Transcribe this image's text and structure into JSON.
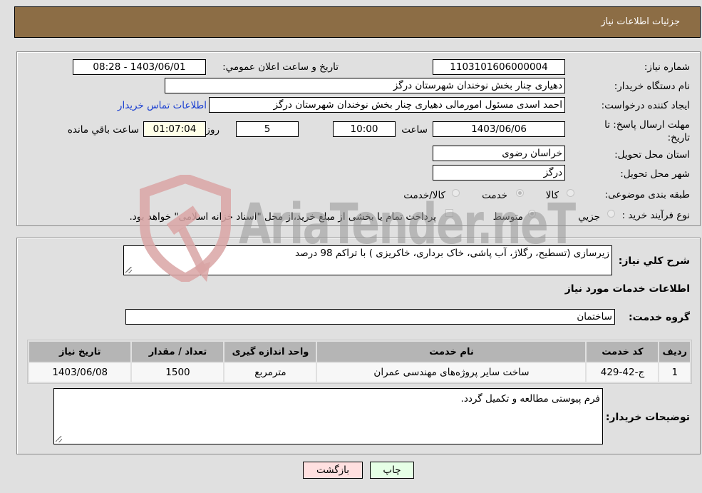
{
  "header": {
    "title": "جزئیات اطلاعات نیاز"
  },
  "form": {
    "need_number": {
      "label": "شماره نیاز:",
      "value": "1103101606000004"
    },
    "announce_datetime": {
      "label": "تاریخ و ساعت اعلان عمومي:",
      "value": "1403/06/01 - 08:28"
    },
    "buyer_org": {
      "label": "نام دستگاه خريدار:",
      "value": "دهیاری چنار بخش نوخندان شهرستان درگز"
    },
    "requester": {
      "label": "ايجاد کننده درخواست:",
      "value": "احمد اسدی مسئول امورمالی دهیاری چنار بخش نوخندان شهرستان درگز"
    },
    "buyer_contact_link": "اطلاعات تماس خريدار",
    "deadline": {
      "label": "مهلت ارسال پاسخ: تا تاريخ:",
      "date": "1403/06/06",
      "time_label": "ساعت",
      "time": "10:00",
      "days": "5",
      "days_label": "روز و",
      "remaining": "01:07:04",
      "remaining_label": "ساعت باقي مانده"
    },
    "delivery_province": {
      "label": "استان محل تحويل:",
      "value": "خراسان رضوی"
    },
    "delivery_city": {
      "label": "شهر محل تحويل:",
      "value": "درگز"
    },
    "category": {
      "label": "طبقه بندی موضوعی:",
      "options": [
        {
          "label": "کالا",
          "checked": false
        },
        {
          "label": "خدمت",
          "checked": true
        },
        {
          "label": "کالا/خدمت",
          "checked": false
        }
      ]
    },
    "purchase_type": {
      "label": "نوع فرآيند خريد :",
      "options": [
        {
          "label": "جزيي",
          "checked": false
        },
        {
          "label": "متوسط",
          "checked": true
        }
      ],
      "treasury_note": "پرداخت تمام يا بخشی از مبلغ خريد،از محل \"اسناد خزانه اسلامی\" خواهد بود.",
      "treasury_checked": false
    }
  },
  "details": {
    "description_label": "شرح کلي نياز:",
    "description": "زیرسازی (تسطیح، رگلاژ، آب پاشی، خاک برداری، خاکریزی ) با تراکم 98 درصد",
    "services_heading": "اطلاعات خدمات مورد نياز",
    "service_group_label": "گروه خدمت:",
    "service_group": "ساختمان",
    "table": {
      "headers": [
        "رديف",
        "کد خدمت",
        "نام خدمت",
        "واحد اندازه گيری",
        "تعداد / مقدار",
        "تاريخ نياز"
      ],
      "rows": [
        [
          "1",
          "ج-42-429",
          "ساخت سایر پروژه‌های مهندسی عمران",
          "مترمربع",
          "1500",
          "1403/06/08"
        ]
      ]
    },
    "buyer_notes_label": "توضيحات خريدار:",
    "buyer_notes": "فرم پیوستی مطالعه و تکمیل گردد."
  },
  "buttons": {
    "print": "چاپ",
    "back": "بازگشت"
  },
  "watermark": {
    "text": "AriaTender.neT"
  },
  "colors": {
    "header_bg": "#8c6d45",
    "link": "#1a3fd1",
    "back_btn": "#ffe0e0",
    "print_btn": "#e6ffe6",
    "remaining_bg": "#ffffe8"
  }
}
